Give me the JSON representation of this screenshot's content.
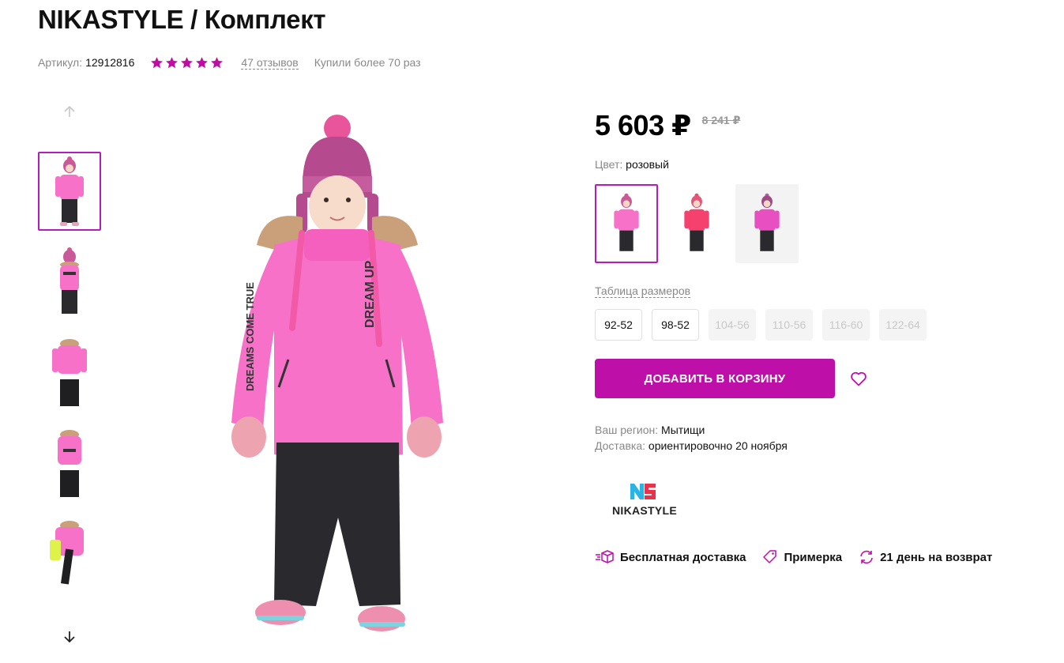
{
  "product": {
    "title": "NIKASTYLE / Комплект",
    "article_label": "Артикул:",
    "article_value": "12912816",
    "rating": 5,
    "reviews": "47 отзывов",
    "bought": "Купили более 70 раз"
  },
  "price": {
    "current": "5 603 ₽",
    "old": "8 241 ₽"
  },
  "color": {
    "label": "Цвет:",
    "value": "розовый",
    "options": [
      "pink",
      "coral",
      "pink-purple"
    ]
  },
  "sizes": {
    "table_label": "Таблица размеров",
    "items": [
      {
        "label": "92-52",
        "available": true
      },
      {
        "label": "98-52",
        "available": true
      },
      {
        "label": "104-56",
        "available": false
      },
      {
        "label": "110-56",
        "available": false
      },
      {
        "label": "116-60",
        "available": false
      },
      {
        "label": "122-64",
        "available": false
      }
    ]
  },
  "cart": {
    "button_label": "ДОБАВИТЬ В КОРЗИНУ"
  },
  "region": {
    "label": "Ваш регион:",
    "value": "Мытищи"
  },
  "delivery": {
    "label": "Доставка:",
    "value": "ориентировочно 20 ноября"
  },
  "brand": {
    "name": "NIKASTYLE"
  },
  "features": [
    {
      "icon": "delivery-box-icon",
      "label": "Бесплатная доставка"
    },
    {
      "icon": "tag-icon",
      "label": "Примерка"
    },
    {
      "icon": "return-arrows-icon",
      "label": "21 день на возврат"
    }
  ],
  "colors": {
    "accent": "#bf0fa9",
    "star": "#c20ba6",
    "jacket_pink": "#f771c8",
    "pants_dark": "#2a2a2e"
  }
}
